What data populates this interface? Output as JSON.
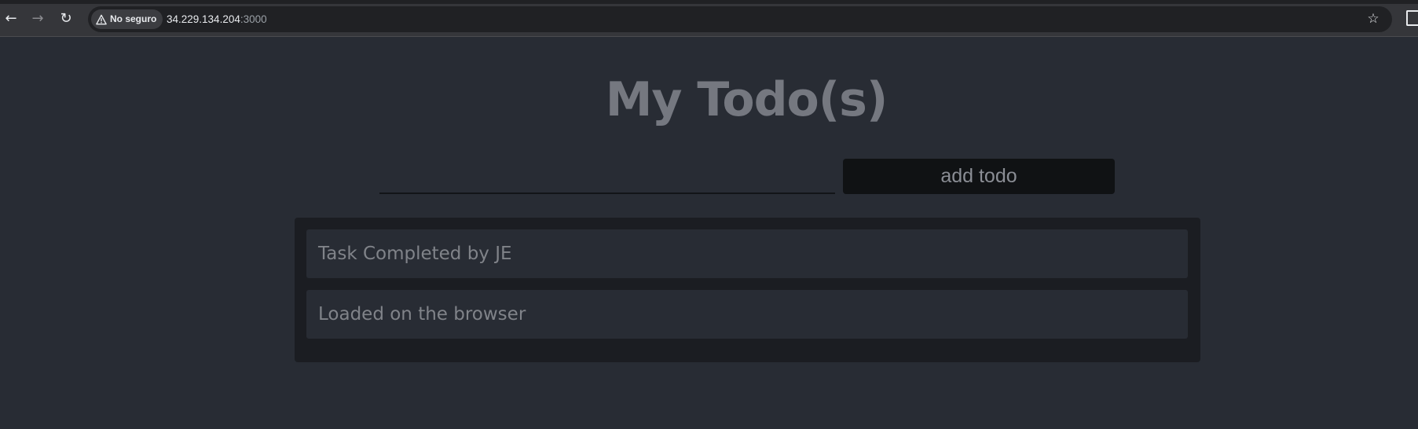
{
  "browser": {
    "security_label": "No seguro",
    "url_host": "34.229.134.204",
    "url_port": ":3000",
    "icons": [
      "back-icon",
      "forward-icon",
      "reload-icon",
      "warning-icon",
      "star-icon",
      "extensions-icon"
    ]
  },
  "app": {
    "title": "My Todo(s)",
    "input": {
      "value": "",
      "placeholder": ""
    },
    "add_button_label": "add todo",
    "todos": [
      {
        "text": "Task Completed by JE"
      },
      {
        "text": "Loaded on the browser"
      }
    ]
  },
  "colors": {
    "background": "#282c34",
    "list_background": "#1b1d22",
    "button_background": "#101214"
  }
}
